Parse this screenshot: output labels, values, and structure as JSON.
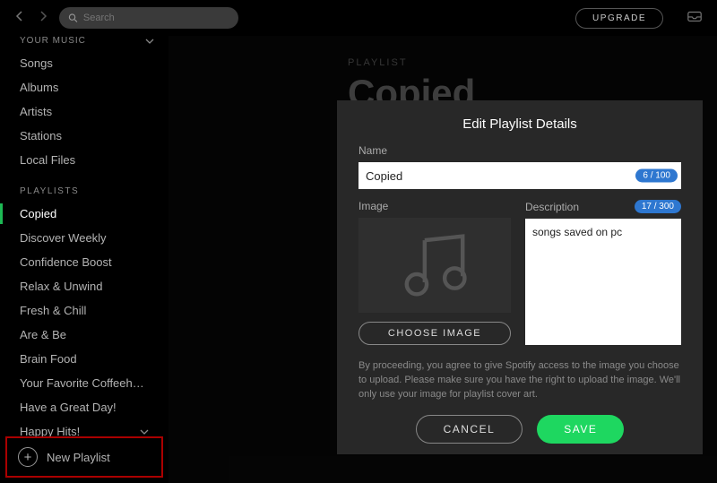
{
  "topbar": {
    "search_placeholder": "Search",
    "upgrade_label": "UPGRADE"
  },
  "sidebar": {
    "your_music_label": "YOUR MUSIC",
    "your_music_items": [
      "Songs",
      "Albums",
      "Artists",
      "Stations",
      "Local Files"
    ],
    "playlists_label": "PLAYLISTS",
    "playlists": [
      "Copied",
      "Discover Weekly",
      "Confidence Boost",
      "Relax & Unwind",
      "Fresh & Chill",
      "Are & Be",
      "Brain Food",
      "Your Favorite Coffeeh…",
      "Have a Great Day!",
      "Happy Hits!"
    ],
    "active_playlist_index": 0,
    "new_playlist_label": "New Playlist"
  },
  "hero": {
    "kicker": "PLAYLIST",
    "title": "Copied"
  },
  "modal": {
    "title": "Edit Playlist Details",
    "name_label": "Name",
    "name_value": "Copied",
    "name_count": "6 / 100",
    "image_label": "Image",
    "choose_image_label": "CHOOSE IMAGE",
    "description_label": "Description",
    "description_value": "songs saved on pc",
    "description_count": "17 / 300",
    "legal": "By proceeding, you agree to give Spotify access to the image you choose to upload. Please make sure you have the right to upload the image. We'll only use your image for playlist cover art.",
    "cancel_label": "CANCEL",
    "save_label": "SAVE"
  }
}
